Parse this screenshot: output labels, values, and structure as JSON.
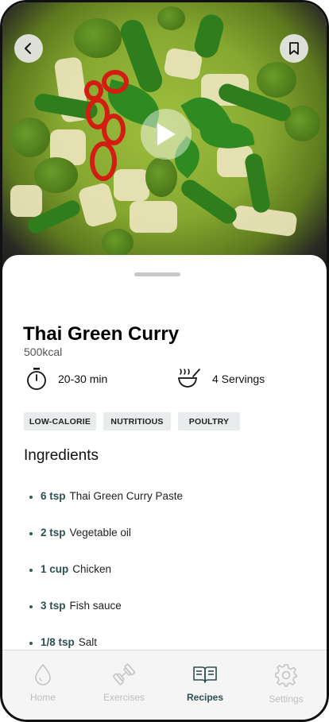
{
  "recipe": {
    "title": "Thai Green Curry",
    "kcal": "500kcal",
    "time": "20-30 min",
    "servings": "4 Servings",
    "tags": [
      "LOW-CALORIE",
      "NUTRITIOUS",
      "POULTRY"
    ]
  },
  "ingredients_title": "Ingredients",
  "ingredients": [
    {
      "qty": "6 tsp",
      "name": "Thai Green Curry Paste"
    },
    {
      "qty": "2 tsp",
      "name": "Vegetable oil"
    },
    {
      "qty": "1 cup",
      "name": "Chicken"
    },
    {
      "qty": "3 tsp",
      "name": "Fish sauce"
    },
    {
      "qty": "1/8 tsp",
      "name": "Salt"
    }
  ],
  "nav": [
    {
      "label": "Home",
      "icon": "drop-icon",
      "active": false
    },
    {
      "label": "Exercises",
      "icon": "dumbbell-icon",
      "active": false
    },
    {
      "label": "Recipes",
      "icon": "book-icon",
      "active": true
    },
    {
      "label": "Settings",
      "icon": "gear-icon",
      "active": false
    }
  ],
  "colors": {
    "accent": "#2d4f50",
    "tag_bg": "#e8ecec",
    "inactive": "#bdbdbd"
  }
}
